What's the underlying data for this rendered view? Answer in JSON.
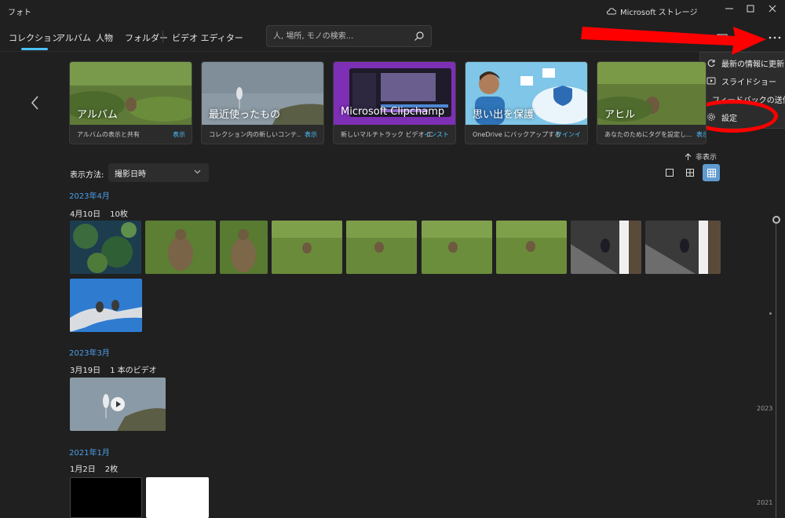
{
  "app": {
    "title": "フォト",
    "storage_label": "Microsoft ストレージ"
  },
  "nav": {
    "tabs": [
      {
        "label": "コレクション",
        "active": true
      },
      {
        "label": "アルバム"
      },
      {
        "label": "人物"
      },
      {
        "label": "フォルダー"
      },
      {
        "label": "ビデオ エディター"
      }
    ],
    "search_placeholder": "人, 場所, モノの検索..."
  },
  "menu": {
    "items": [
      {
        "label": "最新の情報に更新",
        "icon": "refresh-icon"
      },
      {
        "label": "スライドショー",
        "icon": "slideshow-icon"
      },
      {
        "label": "フィードバックの送信",
        "icon": "feedback-icon"
      },
      {
        "label": "設定",
        "icon": "gear-icon"
      }
    ]
  },
  "cards": [
    {
      "title": "アルバム",
      "desc": "アルバムの表示と共有",
      "action": "表示"
    },
    {
      "title": "最近使ったもの",
      "desc": "コレクション内の新しいコンテ...",
      "action": "表示"
    },
    {
      "title": "Microsoft Clipchamp",
      "desc": "新しいマルチトラック ビデオ エ...",
      "action": "インスト"
    },
    {
      "title": "思い出を保護",
      "desc": "OneDrive にバックアップする",
      "action": "サインイ"
    },
    {
      "title": "アヒル",
      "desc": "あなたのためにタグを設定し...",
      "action": "表示"
    }
  ],
  "hide_label": "非表示",
  "view": {
    "sort_label": "表示方法:",
    "sort_value": "撮影日時"
  },
  "groups": [
    {
      "month": "2023年4月",
      "date": "4月10日",
      "count": "10枚"
    },
    {
      "month": "2023年3月",
      "date": "3月19日",
      "count": "1 本のビデオ"
    },
    {
      "month": "2021年1月",
      "date": "1月2日",
      "count": "2枚"
    }
  ],
  "timeline": {
    "years": [
      "2023",
      "2021"
    ]
  },
  "colors": {
    "accent": "#4cc2ff",
    "highlight": "#ff0000",
    "background": "#202020"
  }
}
